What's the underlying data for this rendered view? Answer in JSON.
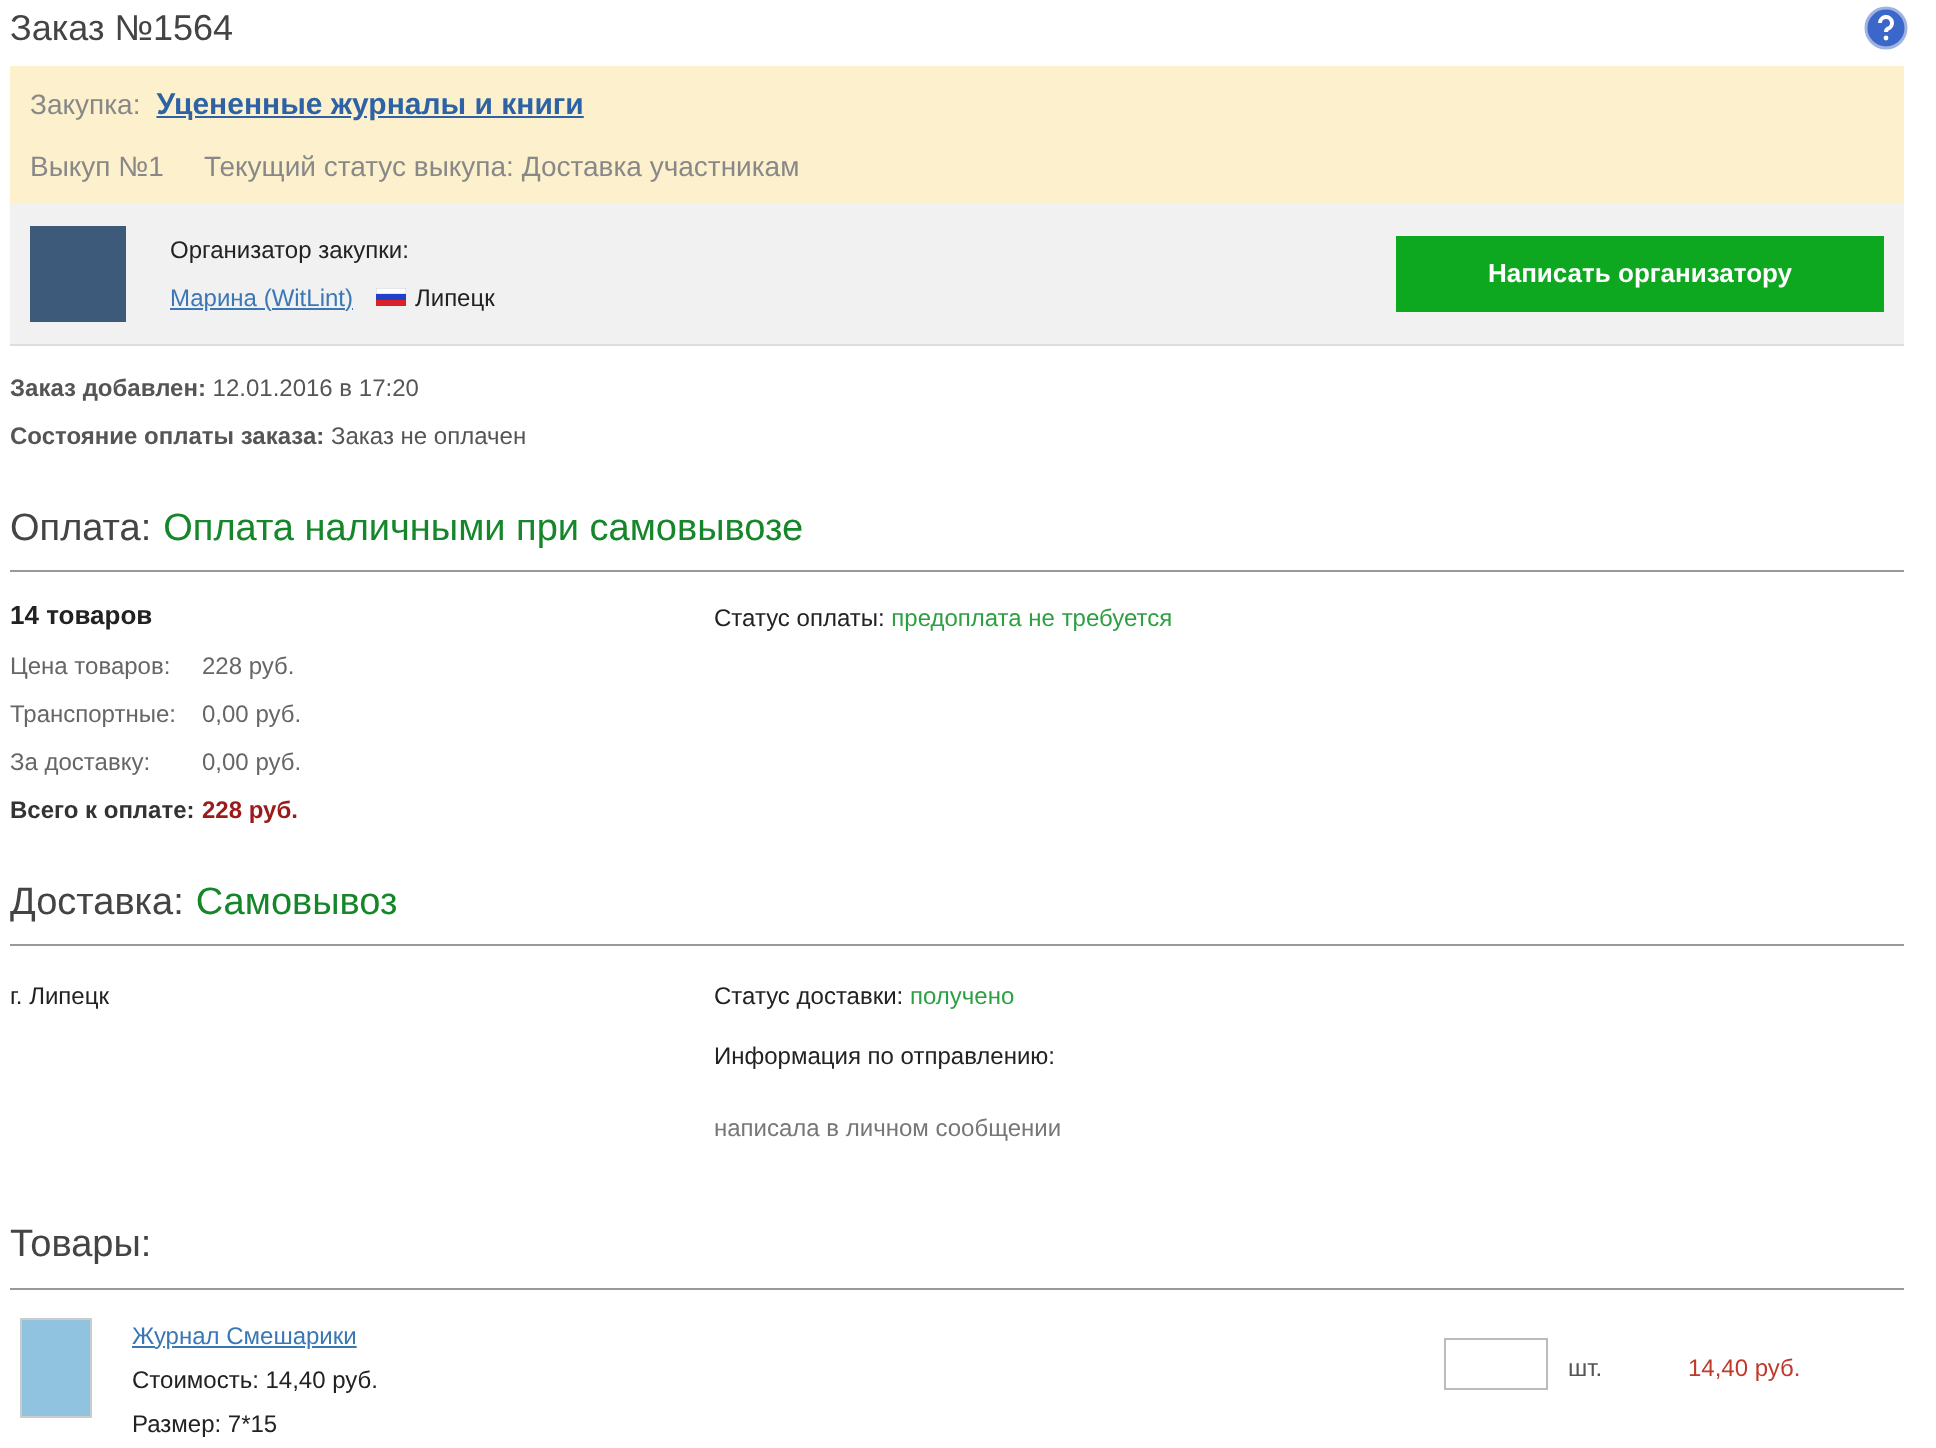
{
  "title": "Заказ №1564",
  "purchase": {
    "label": "Закупка:",
    "name": "Уцененные журналы и книги",
    "round": "Выкуп №1",
    "status": "Текущий статус выкупа: Доставка участникам"
  },
  "organizer": {
    "label": "Организатор закупки:",
    "name": "Марина (WitLint)",
    "city": "Липецк",
    "button": "Написать организатору"
  },
  "order_info": [
    {
      "label": "Заказ добавлен:",
      "value": "12.01.2016 в 17:20"
    },
    {
      "label": "Состояние оплаты заказа:",
      "value": "Заказ не оплачен"
    }
  ],
  "payment": {
    "heading": "Оплата:",
    "method": "Оплата наличными при самовывозе",
    "count": "14 товаров",
    "rows": [
      {
        "label": "Цена товаров:",
        "value": "228 руб.",
        "total": false
      },
      {
        "label": "Транспортные:",
        "value": "0,00 руб.",
        "total": false
      },
      {
        "label": "За доставку:",
        "value": "0,00 руб.",
        "total": false
      },
      {
        "label": "Всего к оплате:",
        "value": "228 руб.",
        "total": true
      }
    ],
    "status_label": "Статус оплаты:",
    "status": "предоплата не требуется"
  },
  "delivery": {
    "heading": "Доставка:",
    "method": "Самовывоз",
    "city": "г. Липецк",
    "status_label": "Статус доставки:",
    "status": "получено",
    "info_label": "Информация по отправлению:",
    "info": "написала в личном сообщении"
  },
  "goods": {
    "heading": "Товары:",
    "items": [
      {
        "name": "Журнал Смешарики",
        "price": "Стоимость: 14,40 руб.",
        "size": "Размер: 7*15",
        "unit": "шт.",
        "sum": "14,40 руб."
      }
    ]
  }
}
